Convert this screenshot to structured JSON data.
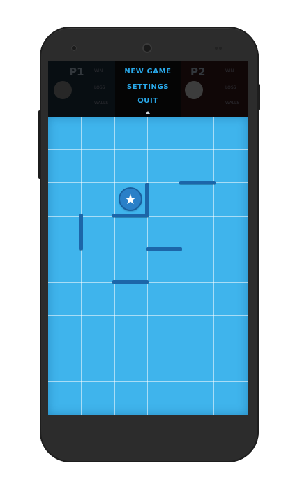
{
  "menu": {
    "new_game": "NEW GAME",
    "settings": "SETTINGS",
    "quit": "QUIT"
  },
  "players": {
    "p1": {
      "label": "P1",
      "stat1": "WIN",
      "stat2": "LOSS",
      "stat3": "WALLS"
    },
    "p2": {
      "label": "P2",
      "stat1": "WIN",
      "stat2": "LOSS",
      "stat3": "WALLS"
    }
  },
  "game_piece": {
    "symbol": "★",
    "icon": "star-icon",
    "color": "#2a80c8"
  },
  "colors": {
    "board": "#3fb4ec",
    "wall": "#1c66a9",
    "menu_text": "#29a9ea"
  }
}
